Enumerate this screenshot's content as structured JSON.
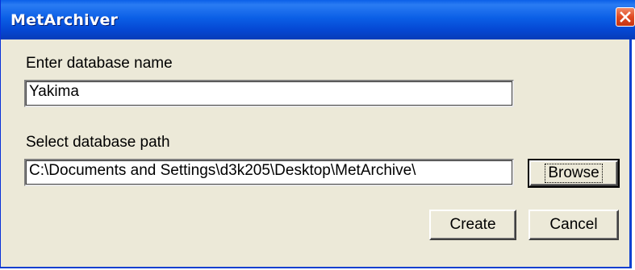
{
  "window": {
    "title": "MetArchiver"
  },
  "form": {
    "name_label": "Enter database name",
    "name_value": "Yakima",
    "path_label": "Select database path",
    "path_value": "C:\\Documents and Settings\\d3k205\\Desktop\\MetArchive\\"
  },
  "buttons": {
    "browse": "Browse",
    "create": "Create",
    "cancel": "Cancel"
  },
  "icons": {
    "close": "close-icon"
  },
  "colors": {
    "titlebar": "#0b5fe6",
    "dialog_bg": "#ece9d8",
    "close_button": "#e04a22"
  }
}
